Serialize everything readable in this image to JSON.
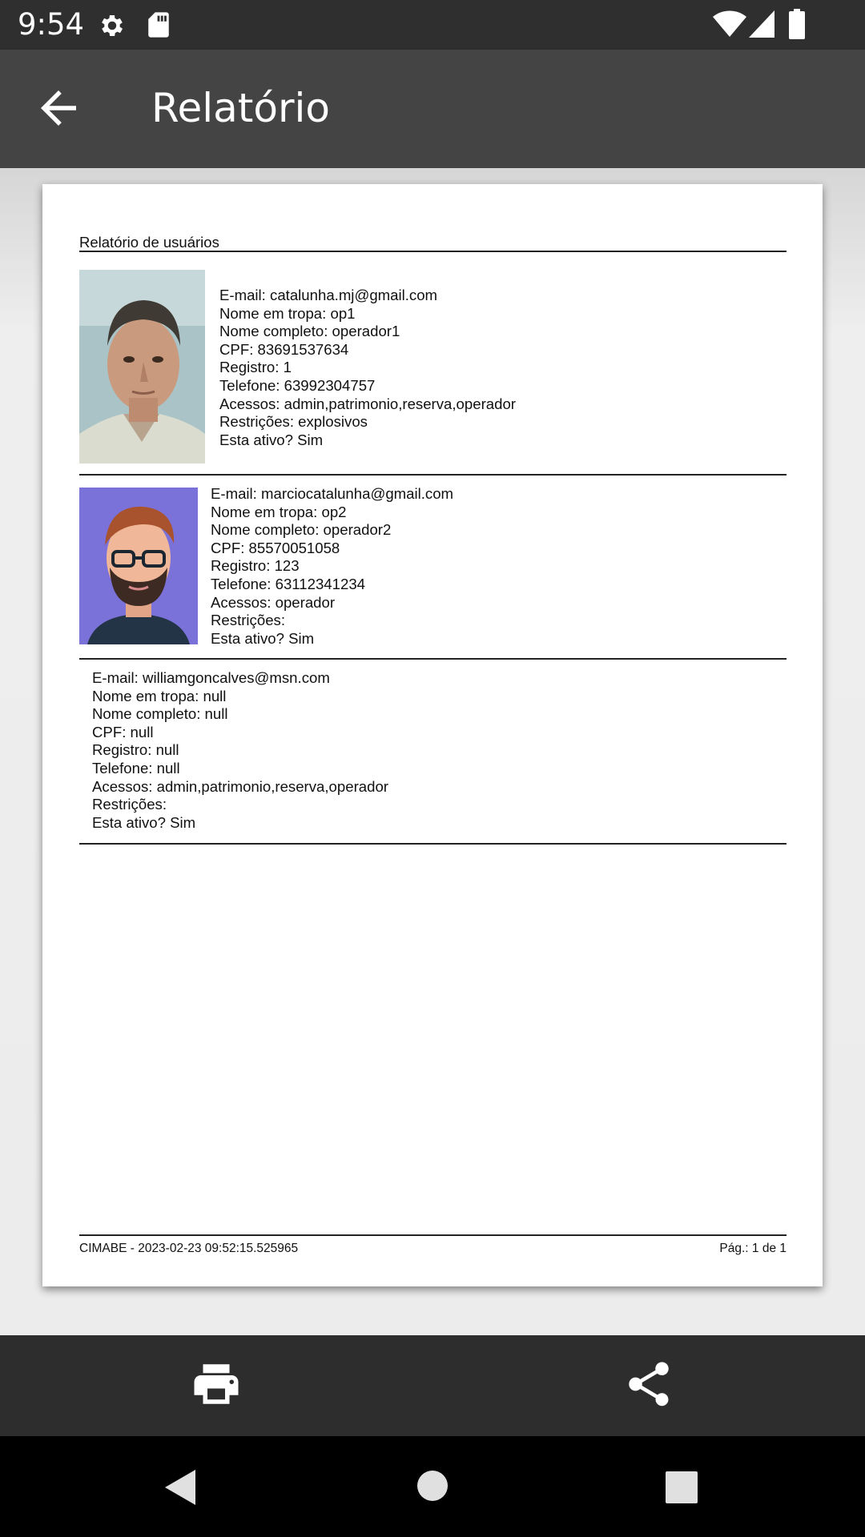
{
  "status_bar": {
    "time": "9:54",
    "icons": [
      "gear-icon",
      "sd-card-icon",
      "wifi-icon",
      "cell-signal-icon",
      "battery-icon"
    ]
  },
  "app_bar": {
    "back_icon": "arrow-back-icon",
    "title": "Relatório"
  },
  "report": {
    "title": "Relatório de usuários",
    "records": [
      {
        "photo": "user-photo-realistic",
        "email": "E-mail: catalunha.mj@gmail.com",
        "nome_tropa": "Nome em tropa: op1",
        "nome_completo": "Nome completo: operador1",
        "cpf": "CPF: 83691537634",
        "registro": "Registro: 1",
        "telefone": "Telefone: 63992304757",
        "acessos": "Acessos: admin,patrimonio,reserva,operador",
        "restricoes": "Restrições: explosivos",
        "ativo": "Esta ativo? Sim"
      },
      {
        "photo": "user-avatar-cartoon",
        "email": "E-mail: marciocatalunha@gmail.com",
        "nome_tropa": "Nome em tropa: op2",
        "nome_completo": "Nome completo: operador2",
        "cpf": "CPF: 85570051058",
        "registro": "Registro: 123",
        "telefone": "Telefone: 63112341234",
        "acessos": "Acessos: operador",
        "restricoes": "Restrições:",
        "ativo": "Esta ativo? Sim"
      },
      {
        "email": "E-mail: williamgoncalves@msn.com",
        "nome_tropa": "Nome em tropa: null",
        "nome_completo": "Nome completo: null",
        "cpf": "CPF: null",
        "registro": "Registro: null",
        "telefone": "Telefone: null",
        "acessos": "Acessos: admin,patrimonio,reserva,operador",
        "restricoes": "Restrições:",
        "ativo": "Esta ativo? Sim"
      }
    ],
    "footer_left": "CIMABE - 2023-02-23 09:52:15.525965",
    "footer_right": "Pág.: 1 de 1"
  },
  "actions": {
    "print_icon": "print-icon",
    "share_icon": "share-icon"
  },
  "nav_bar": {
    "icons": [
      "nav-back-icon",
      "nav-home-icon",
      "nav-recents-icon"
    ]
  },
  "colors": {
    "status_bar": "#2f2f2f",
    "app_bar": "#444444",
    "action_bar": "#2d2d2d",
    "avatar_background": "#7b72d9"
  }
}
